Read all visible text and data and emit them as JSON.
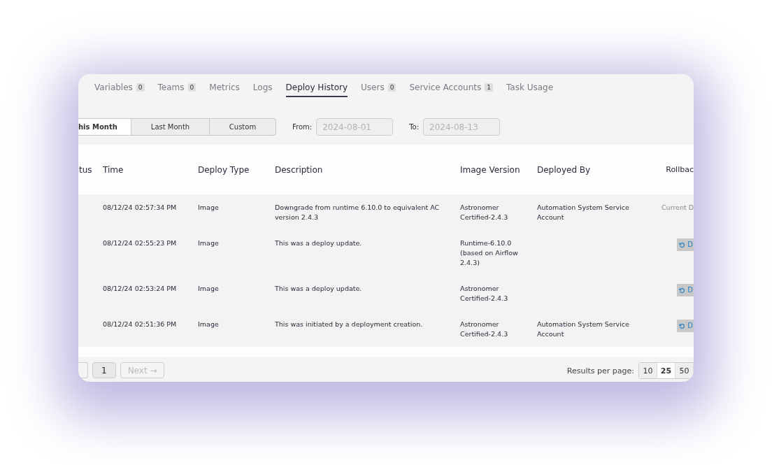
{
  "tabs": [
    {
      "label": "Variables",
      "count": "0",
      "selected": false
    },
    {
      "label": "Teams",
      "count": "0",
      "selected": false
    },
    {
      "label": "Metrics",
      "selected": false
    },
    {
      "label": "Logs",
      "selected": false
    },
    {
      "label": "Deploy History",
      "selected": true
    },
    {
      "label": "Users",
      "count": "0",
      "selected": false
    },
    {
      "label": "Service Accounts",
      "count": "1",
      "selected": false
    },
    {
      "label": "Task Usage",
      "selected": false
    }
  ],
  "range_buttons": [
    {
      "label": "his Month",
      "selected": true
    },
    {
      "label": "Last Month",
      "selected": false
    },
    {
      "label": "Custom",
      "selected": false
    }
  ],
  "from": {
    "label": "From:",
    "placeholder": "2024-08-01"
  },
  "to": {
    "label": "To:",
    "placeholder": "2024-08-13"
  },
  "table": {
    "columns": [
      "tus",
      "Time",
      "Deploy Type",
      "Description",
      "Image Version",
      "Deployed By",
      "Rollbac"
    ],
    "rows": [
      {
        "time": "08/12/24 02:57:34 PM",
        "deploy_type": "Image",
        "description": "Downgrade from runtime 6.10.0 to equivalent AC version 2.4.3",
        "image_version": "Astronomer Certified-2.4.3",
        "deployed_by": "Automation System Service Account",
        "rollback": {
          "kind": "current",
          "label": "Current D"
        }
      },
      {
        "time": "08/12/24 02:55:23 PM",
        "deploy_type": "Image",
        "description": "This was a deploy update.",
        "image_version": "Runtime-6.10.0 (based on Airflow 2.4.3)",
        "rollback": {
          "kind": "button",
          "label": "D"
        }
      },
      {
        "time": "08/12/24 02:53:24 PM",
        "deploy_type": "Image",
        "description": "This was a deploy update.",
        "image_version": "Astronomer Certified-2.4.3",
        "rollback": {
          "kind": "button",
          "label": "D"
        }
      },
      {
        "time": "08/12/24 02:51:36 PM",
        "deploy_type": "Image",
        "description": "This was initiated by a deployment creation.",
        "image_version": "Astronomer Certified-2.4.3",
        "deployed_by": "Automation System Service Account",
        "rollback": {
          "kind": "button",
          "label": "D"
        }
      }
    ]
  },
  "pagination": {
    "pages": [
      {
        "label": "1",
        "selected": true
      }
    ],
    "next": {
      "label": "Next →",
      "disabled": true
    }
  },
  "page_size": {
    "label": "Results per page:",
    "options": [
      {
        "label": "10",
        "selected": false
      },
      {
        "label": "25",
        "selected": true
      },
      {
        "label": "50",
        "selected": false
      }
    ]
  }
}
